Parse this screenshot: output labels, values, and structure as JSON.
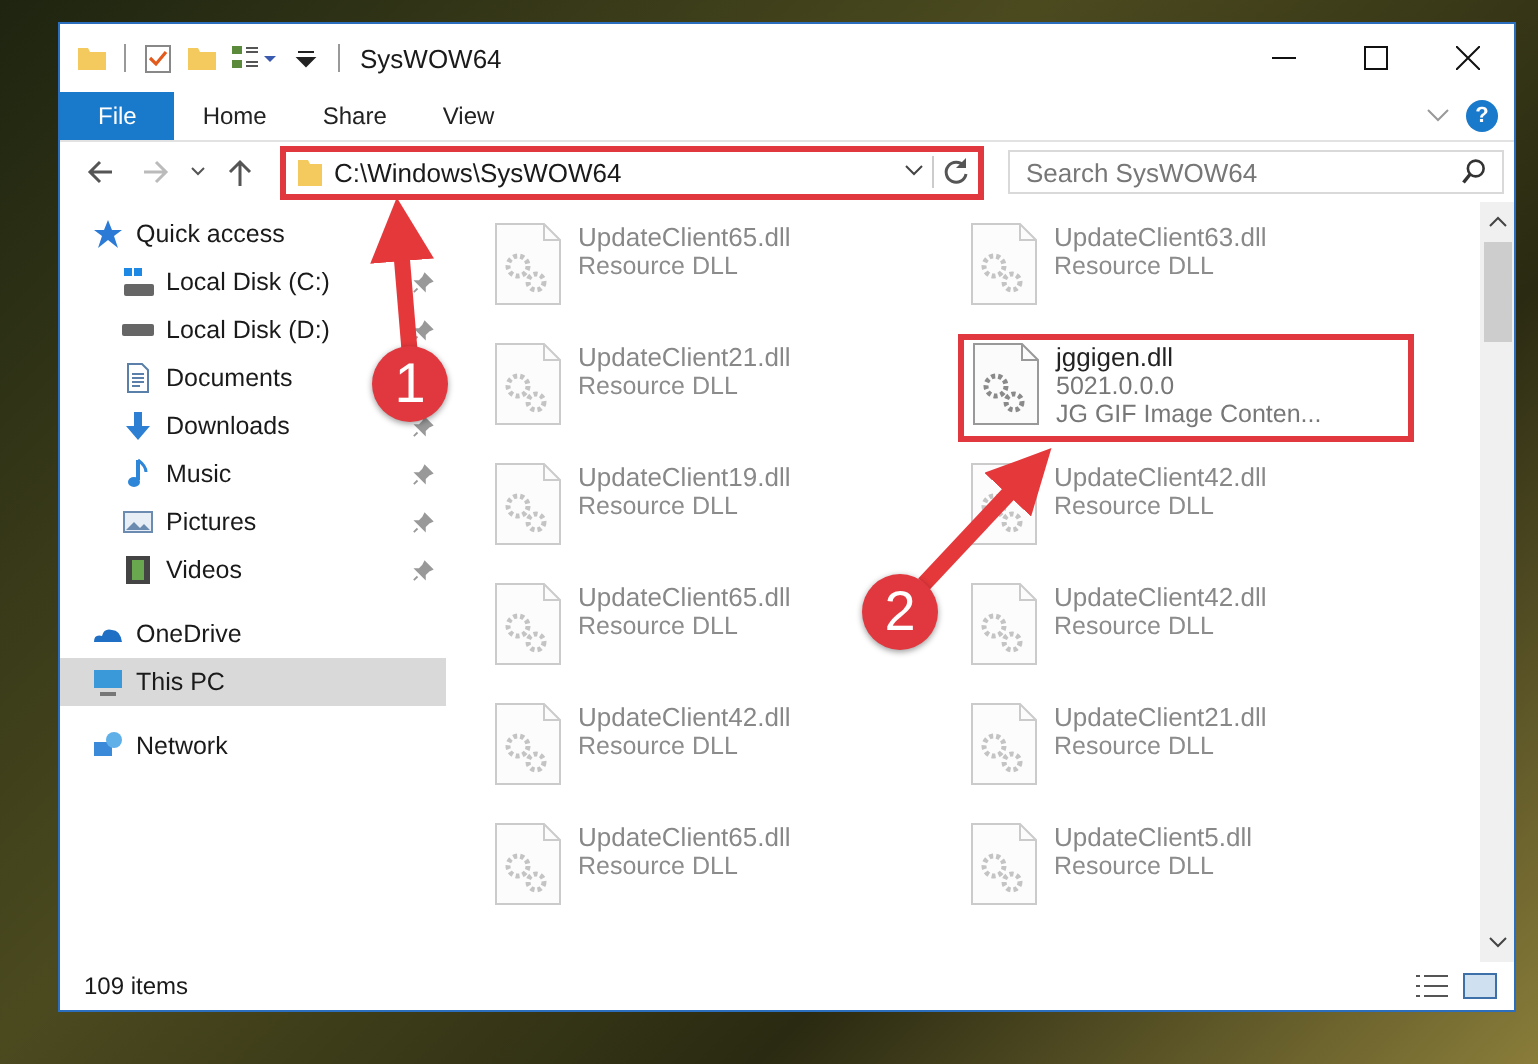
{
  "window": {
    "title": "SysWOW64"
  },
  "ribbon": {
    "tabs": [
      {
        "label": "File",
        "selected": true
      },
      {
        "label": "Home",
        "selected": false
      },
      {
        "label": "Share",
        "selected": false
      },
      {
        "label": "View",
        "selected": false
      }
    ],
    "help": "?"
  },
  "address": {
    "path": "C:\\Windows\\SysWOW64",
    "highlighted": true
  },
  "search": {
    "placeholder": "Search SysWOW64"
  },
  "sidebar": {
    "items": [
      {
        "label": "Quick access",
        "kind": "star",
        "pinned": false,
        "selected": false,
        "children": [
          {
            "label": "Local Disk (C:)",
            "kind": "sysdrive",
            "pinned": true,
            "selected": false
          },
          {
            "label": "Local Disk (D:)",
            "kind": "drive",
            "pinned": true,
            "selected": false
          },
          {
            "label": "Documents",
            "kind": "documents",
            "pinned": false,
            "selected": false
          },
          {
            "label": "Downloads",
            "kind": "downloads",
            "pinned": true,
            "selected": false
          },
          {
            "label": "Music",
            "kind": "music",
            "pinned": true,
            "selected": false
          },
          {
            "label": "Pictures",
            "kind": "pictures",
            "pinned": true,
            "selected": false
          },
          {
            "label": "Videos",
            "kind": "videos",
            "pinned": true,
            "selected": false
          }
        ]
      },
      {
        "label": "OneDrive",
        "kind": "cloud",
        "pinned": false,
        "selected": false
      },
      {
        "label": "This PC",
        "kind": "pc",
        "pinned": false,
        "selected": true
      },
      {
        "label": "Network",
        "kind": "network",
        "pinned": false,
        "selected": false
      }
    ]
  },
  "files": [
    {
      "name": "UpdateClient65.dll",
      "details": [
        "Resource DLL"
      ],
      "highlighted": false
    },
    {
      "name": "UpdateClient63.dll",
      "details": [
        "Resource DLL"
      ],
      "highlighted": false
    },
    {
      "name": "UpdateClient21.dll",
      "details": [
        "Resource DLL"
      ],
      "highlighted": false
    },
    {
      "name": "jggigen.dll",
      "details": [
        "5021.0.0.0",
        "JG GIF Image Conten..."
      ],
      "highlighted": true
    },
    {
      "name": "UpdateClient19.dll",
      "details": [
        "Resource DLL"
      ],
      "highlighted": false
    },
    {
      "name": "UpdateClient42.dll",
      "details": [
        "Resource DLL"
      ],
      "highlighted": false
    },
    {
      "name": "UpdateClient65.dll",
      "details": [
        "Resource DLL"
      ],
      "highlighted": false
    },
    {
      "name": "UpdateClient42.dll",
      "details": [
        "Resource DLL"
      ],
      "highlighted": false
    },
    {
      "name": "UpdateClient42.dll",
      "details": [
        "Resource DLL"
      ],
      "highlighted": false
    },
    {
      "name": "UpdateClient21.dll",
      "details": [
        "Resource DLL"
      ],
      "highlighted": false
    },
    {
      "name": "UpdateClient65.dll",
      "details": [
        "Resource DLL"
      ],
      "highlighted": false
    },
    {
      "name": "UpdateClient5.dll",
      "details": [
        "Resource DLL"
      ],
      "highlighted": false
    }
  ],
  "status_bar": {
    "count": "109 items"
  },
  "annotations": [
    {
      "number": "1"
    },
    {
      "number": "2"
    }
  ]
}
